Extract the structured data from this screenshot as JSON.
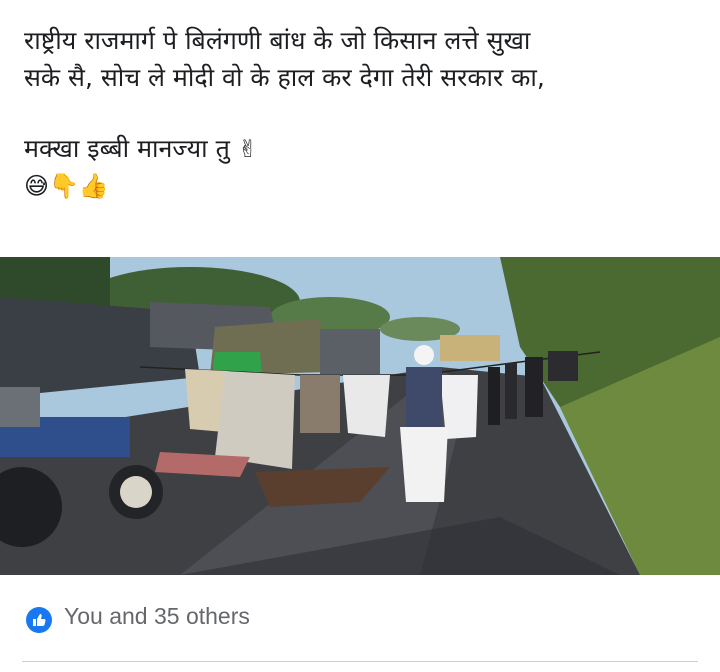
{
  "post": {
    "lines": [
      "राष्ट्रीय राजमार्ग पे बिलंगणी बांध के जो किसान लत्ते सुखा",
      "सके सै, सोच ले मोदी वो के हाल कर देगा तेरी सरकार का,",
      "मक्खा इब्बी मानज्या तु"
    ],
    "line3_emoji": "✌",
    "emoji_row": [
      "😅",
      "👇",
      "👍"
    ]
  },
  "photo": {
    "alt_icon": "photo-farmers-drying-clothes-on-highway"
  },
  "footer": {
    "reactions_text": "You and 35 others",
    "like_icon": "thumbs-up-icon",
    "accent_color": "#1877f2"
  }
}
